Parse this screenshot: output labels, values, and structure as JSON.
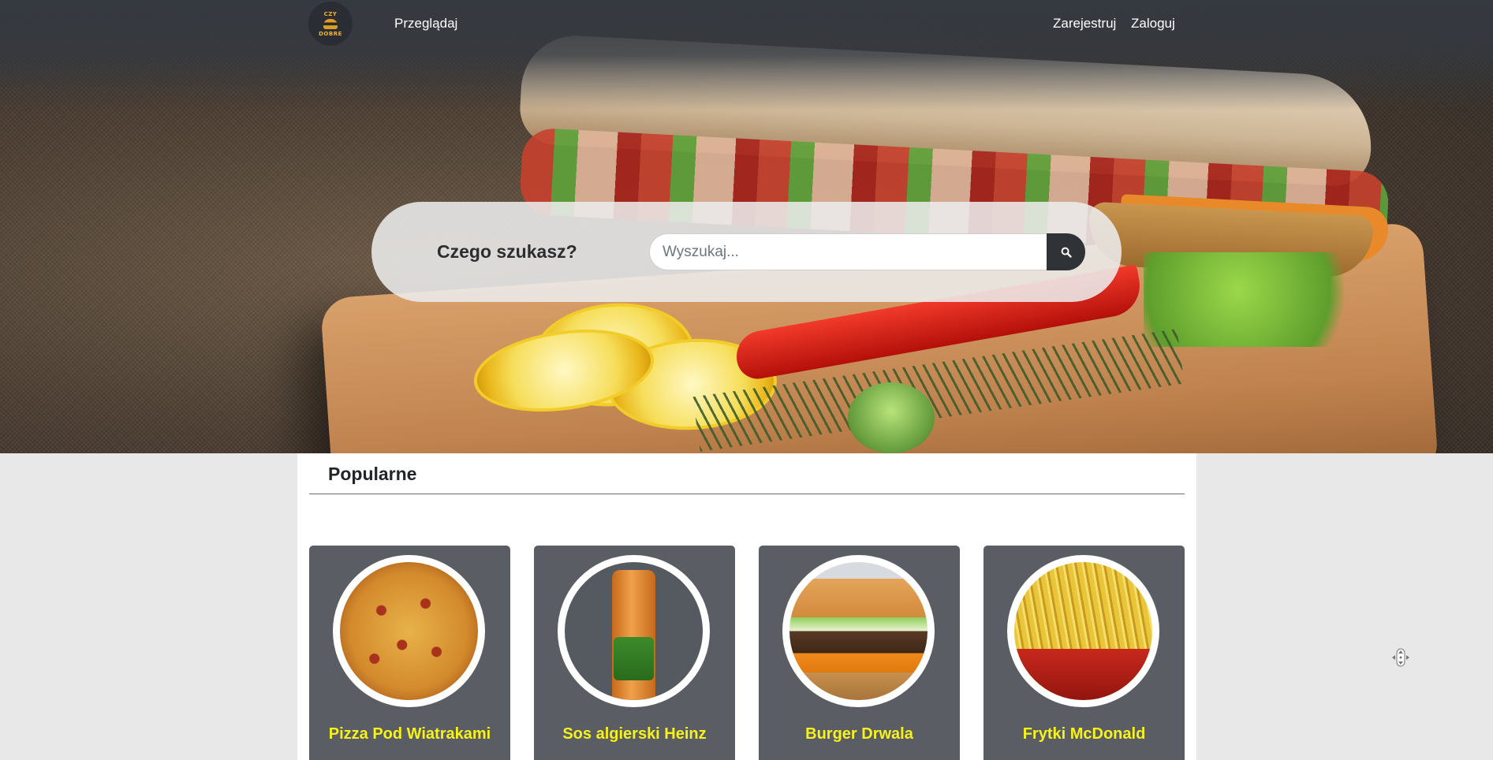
{
  "navbar": {
    "logo": {
      "text_top": "CZY",
      "text_bottom": "DOBRE",
      "icon": "burger-icon"
    },
    "browse_link": "Przeglądaj",
    "register_link": "Zarejestruj",
    "login_link": "Zaloguj"
  },
  "search": {
    "label": "Czego szukasz?",
    "placeholder": "Wyszukaj...",
    "button_icon": "search-icon"
  },
  "popular": {
    "title": "Popularne",
    "items": [
      {
        "name": "Pizza Pod Wiatrakami"
      },
      {
        "name": "Sos algierski Heinz"
      },
      {
        "name": "Burger Drwala"
      },
      {
        "name": "Frytki McDonald"
      }
    ]
  },
  "colors": {
    "navbar_bg": "#353940",
    "card_bg": "#5a5e64",
    "card_title": "#f6f21a",
    "search_button": "#2f3237",
    "page_bg": "#e8e8e8"
  }
}
